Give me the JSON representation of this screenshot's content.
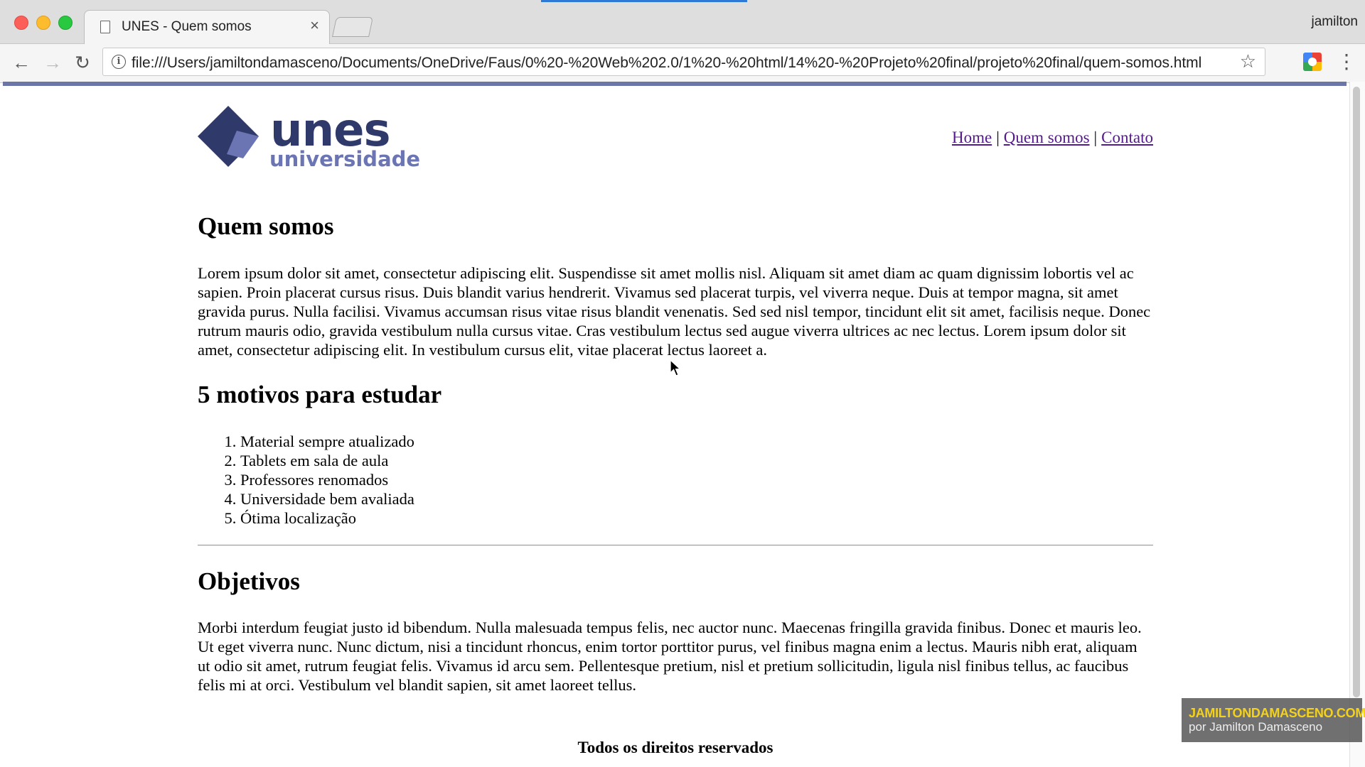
{
  "browser": {
    "tab_title": "UNES - Quem somos",
    "tab_close": "×",
    "profile_name": "jamilton",
    "url": "file:///Users/jamiltondamasceno/Documents/OneDrive/Faus/0%20-%20Web%202.0/1%20-%20html/14%20-%20Projeto%20final/projeto%20final/quem-somos.html",
    "back": "←",
    "forward": "→",
    "reload": "↻",
    "bookmark": "☆",
    "menu": "⋮",
    "info": "i"
  },
  "header": {
    "logo_main": "unes",
    "logo_sub": "universidade",
    "logo_colors": {
      "dark": "#2f3a6b",
      "light": "#6b75b3"
    },
    "nav": [
      {
        "label": "Home"
      },
      {
        "label": "Quem somos"
      },
      {
        "label": "Contato"
      }
    ],
    "nav_separator": "|"
  },
  "main": {
    "about_heading": "Quem somos",
    "about_text": "Lorem ipsum dolor sit amet, consectetur adipiscing elit. Suspendisse sit amet mollis nisl. Aliquam sit amet diam ac quam dignissim lobortis vel ac sapien. Proin placerat cursus risus. Duis blandit varius hendrerit. Vivamus sed placerat turpis, vel viverra neque. Duis at tempor magna, sit amet gravida purus. Nulla facilisi. Vivamus accumsan risus vitae risus blandit venenatis. Sed sed nisl tempor, tincidunt elit sit amet, facilisis neque. Donec rutrum mauris odio, gravida vestibulum nulla cursus vitae. Cras vestibulum lectus sed augue viverra ultrices ac nec lectus. Lorem ipsum dolor sit amet, consectetur adipiscing elit. In vestibulum cursus elit, vitae placerat lectus laoreet a.",
    "reasons_heading": "5 motivos para estudar",
    "reasons": [
      "Material sempre atualizado",
      "Tablets em sala de aula",
      "Professores renomados",
      "Universidade bem avaliada",
      "Ótima localização"
    ],
    "objectives_heading": "Objetivos",
    "objectives_text": "Morbi interdum feugiat justo id bibendum. Nulla malesuada tempus felis, nec auctor nunc. Maecenas fringilla gravida finibus. Donec et mauris leo. Ut eget viverra nunc. Nunc dictum, nisi a tincidunt rhoncus, enim tortor porttitor purus, vel finibus magna enim a lectus. Mauris nibh erat, aliquam ut odio sit amet, rutrum feugiat felis. Vivamus id arcu sem. Pellentesque pretium, nisl et pretium sollicitudin, ligula nisl finibus tellus, ac faucibus felis mi at orci. Vestibulum vel blandit sapien, sit amet laoreet tellus."
  },
  "footer": {
    "text": "Todos os direitos reservados"
  },
  "watermark": {
    "line1": "JAMILTONDAMASCENO.COM",
    "line2": "por Jamilton Damasceno"
  }
}
